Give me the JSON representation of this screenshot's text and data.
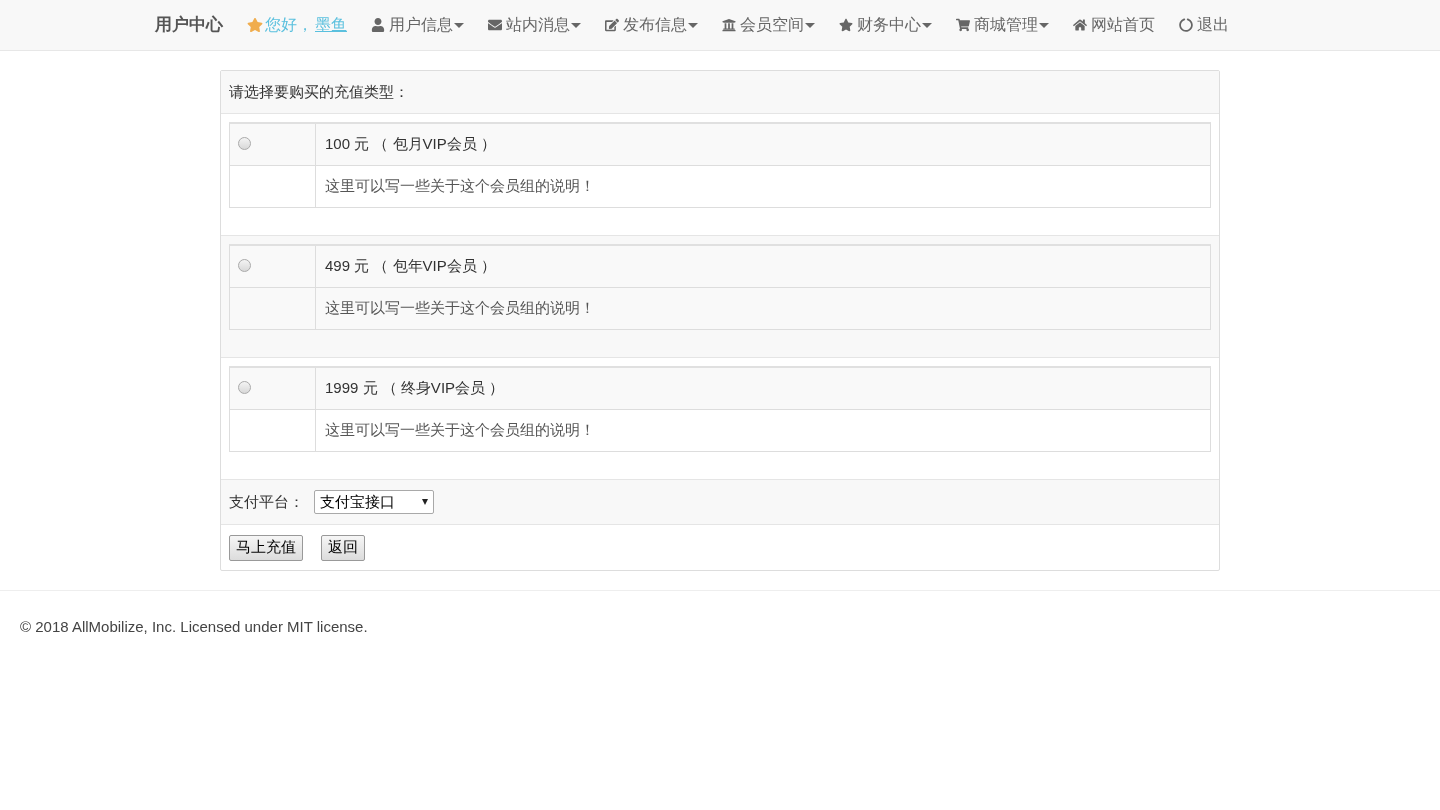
{
  "navbar": {
    "brand": "用户中心",
    "greeting": "您好，",
    "username": "墨鱼",
    "items": [
      {
        "label": "用户信息",
        "dropdown": true
      },
      {
        "label": "站内消息",
        "dropdown": true
      },
      {
        "label": "发布信息",
        "dropdown": true
      },
      {
        "label": "会员空间",
        "dropdown": true
      },
      {
        "label": "财务中心",
        "dropdown": true
      },
      {
        "label": "商城管理",
        "dropdown": true
      },
      {
        "label": "网站首页",
        "dropdown": false
      },
      {
        "label": "退出",
        "dropdown": false
      }
    ]
  },
  "form": {
    "heading": "请选择要购买的充值类型：",
    "plans": [
      {
        "price": "100 元 （ 包月VIP会员 ）",
        "description": "这里可以写一些关于这个会员组的说明！",
        "selected": false
      },
      {
        "price": "499 元 （ 包年VIP会员 ）",
        "description": "这里可以写一些关于这个会员组的说明！",
        "selected": false
      },
      {
        "price": "1999 元 （ 终身VIP会员 ）",
        "description": "这里可以写一些关于这个会员组的说明！",
        "selected": false
      }
    ],
    "payment_label": "支付平台：",
    "payment_value": "支付宝接口",
    "buttons": [
      "马上充值",
      "返回"
    ]
  },
  "footer": "© 2018 AllMobilize, Inc. Licensed under MIT license."
}
